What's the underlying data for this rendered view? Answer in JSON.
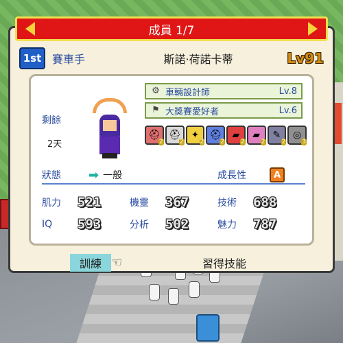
{
  "title": "成員 1/7",
  "member": {
    "rank": "1st",
    "job": "賽車手",
    "name": "斯諾·荷諾卡蒂",
    "level": "Lv91"
  },
  "remain": {
    "label": "剩餘",
    "days": "2天"
  },
  "skills": [
    {
      "name": "車輛設計師",
      "level": "Lv.8",
      "icon": "wrench-icon"
    },
    {
      "name": "大獎賽愛好者",
      "level": "Lv.6",
      "icon": "checkered-flag-icon"
    }
  ],
  "items": [
    {
      "icon": "helmet-red-icon",
      "count": "2",
      "color": "#e07070"
    },
    {
      "icon": "helmet-white-icon",
      "count": "2",
      "color": "#d9d9d9"
    },
    {
      "icon": "parts-yellow-icon",
      "count": "2",
      "color": "#f0d040"
    },
    {
      "icon": "helmet-blue-icon",
      "count": "2",
      "color": "#6080e0"
    },
    {
      "icon": "car-red-icon",
      "count": "2",
      "color": "#e04040"
    },
    {
      "icon": "car-pink-icon",
      "count": "2",
      "color": "#e080c0"
    },
    {
      "icon": "tool-icon",
      "count": "2",
      "color": "#8080a0"
    },
    {
      "icon": "tire-icon",
      "count": "3",
      "color": "#909090"
    }
  ],
  "status": {
    "label": "狀態",
    "value": "一般",
    "growth_label": "成長性",
    "growth_grade": "A"
  },
  "stats": [
    [
      {
        "label": "肌力",
        "value": "521"
      },
      {
        "label": "機靈",
        "value": "367"
      },
      {
        "label": "技術",
        "value": "688"
      }
    ],
    [
      {
        "label": "IQ",
        "value": "593"
      },
      {
        "label": "分析",
        "value": "502"
      },
      {
        "label": "魅力",
        "value": "787"
      }
    ]
  ],
  "buttons": {
    "train": "訓練",
    "learn_skill": "習得技能"
  },
  "colors": {
    "title_bar": "#e01616",
    "rank_badge": "#1f5fc7",
    "label_text": "#2a4ca0",
    "level_text": "#d28a12"
  }
}
